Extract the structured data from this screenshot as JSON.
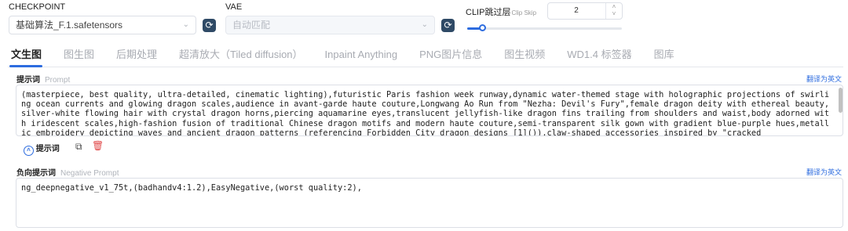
{
  "checkpoint": {
    "label": "CHECKPOINT",
    "value": "基础算法_F.1.safetensors"
  },
  "vae": {
    "label": "VAE",
    "placeholder": "自动匹配"
  },
  "clip_skip": {
    "label": "CLIP跳过层",
    "sub_label": "Clip Skip",
    "value": "2",
    "slider_fraction": 0.1
  },
  "tabs": [
    {
      "label": "文生图",
      "active": true
    },
    {
      "label": "图生图"
    },
    {
      "label": "后期处理"
    },
    {
      "label": "超清放大（Tiled diffusion）"
    },
    {
      "label": "Inpaint Anything"
    },
    {
      "label": "PNG图片信息"
    },
    {
      "label": "图生视频"
    },
    {
      "label": "WD1.4 标签器"
    },
    {
      "label": "图库"
    }
  ],
  "prompt": {
    "label": "提示词",
    "sub_label": "Prompt",
    "translate": "翻译为英文",
    "text": "(masterpiece, best quality, ultra-detailed, cinematic lighting),futuristic Paris fashion week runway,dynamic water-themed stage with holographic projections of swirling ocean currents and glowing dragon scales,audience in avant-garde haute couture,Longwang Ao Run from \"Nezha: Devil's Fury\",female dragon deity with ethereal beauty,silver-white flowing hair with crystal dragon horns,piercing aquamarine eyes,translucent jellyfish-like dragon fins trailing from shoulders and waist,body adorned with iridescent scales,high-fashion fusion of traditional Chinese dragon motifs and modern haute couture,semi-transparent silk gown with gradient blue-purple hues,metallic embroidery depicting waves and ancient dragon patterns (referencing Forbidden City dragon designs [1]()),claw-shaped accessories inspired by \"cracked",
    "toggle_label": "提示词"
  },
  "negative_prompt": {
    "label": "负向提示词",
    "sub_label": "Negative Prompt",
    "translate": "翻译为英文",
    "text": "ng_deepnegative_v1_75t,(badhandv4:1.2),EasyNegative,(worst quality:2),"
  }
}
